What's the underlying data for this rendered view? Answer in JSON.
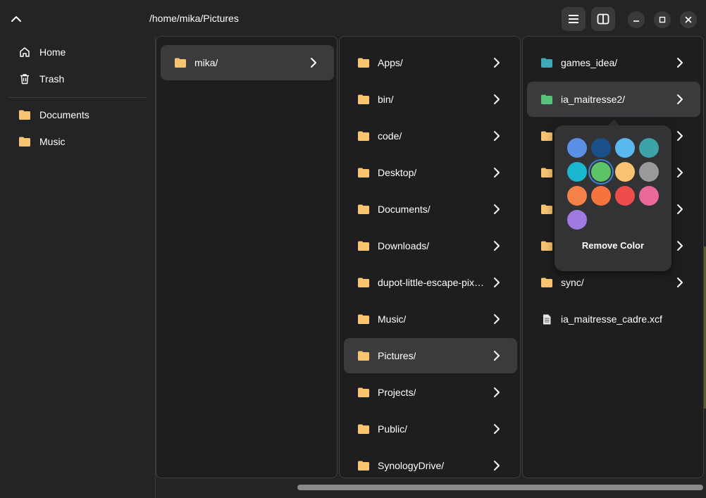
{
  "header": {
    "path": "/home/mika/Pictures"
  },
  "sidebar": {
    "items": [
      {
        "label": "Home",
        "icon": "home-icon"
      },
      {
        "label": "Trash",
        "icon": "trash-icon"
      },
      {
        "label": "Documents",
        "icon": "folder-icon"
      },
      {
        "label": "Music",
        "icon": "folder-icon"
      }
    ]
  },
  "columns": [
    {
      "items": [
        {
          "name": "mika/",
          "selected": true
        }
      ]
    },
    {
      "items": [
        {
          "name": "Apps/"
        },
        {
          "name": "bin/"
        },
        {
          "name": "code/"
        },
        {
          "name": "Desktop/"
        },
        {
          "name": "Documents/"
        },
        {
          "name": "Downloads/"
        },
        {
          "name": "dupot-little-escape-pix…"
        },
        {
          "name": "Music/"
        },
        {
          "name": "Pictures/",
          "selected": true
        },
        {
          "name": "Projects/"
        },
        {
          "name": "Public/"
        },
        {
          "name": "SynologyDrive/"
        }
      ]
    },
    {
      "items": [
        {
          "name": "games_idea/",
          "folder_color": "#3fa9b5"
        },
        {
          "name": "ia_maitresse2/",
          "folder_color": "#58c27d",
          "selected": true
        },
        {
          "name": "",
          "folder_color": "#f8c471"
        },
        {
          "name": "",
          "folder_color": "#f8c471"
        },
        {
          "name": "",
          "folder_color": "#f8c471"
        },
        {
          "name": "",
          "folder_color": "#f8c471"
        },
        {
          "name": "sync/",
          "folder_color": "#f8c471"
        },
        {
          "name": "ia_maitresse_cadre.xcf",
          "type": "file"
        }
      ]
    }
  ],
  "color_popover": {
    "swatches": [
      "#5b8fe6",
      "#1a4f8a",
      "#5ab8ec",
      "#3ea3a8",
      "#1ab6cf",
      "#5cc466",
      "#f8c471",
      "#9a9a9a",
      "#f5824a",
      "#f5733c",
      "#ee4b4b",
      "#e96a9a",
      "#a07ae0"
    ],
    "selected_index": 5,
    "remove_label": "Remove Color"
  },
  "colors": {
    "folder_default": "#f8c471",
    "accent": "#3b82d6",
    "background": "#242427"
  }
}
